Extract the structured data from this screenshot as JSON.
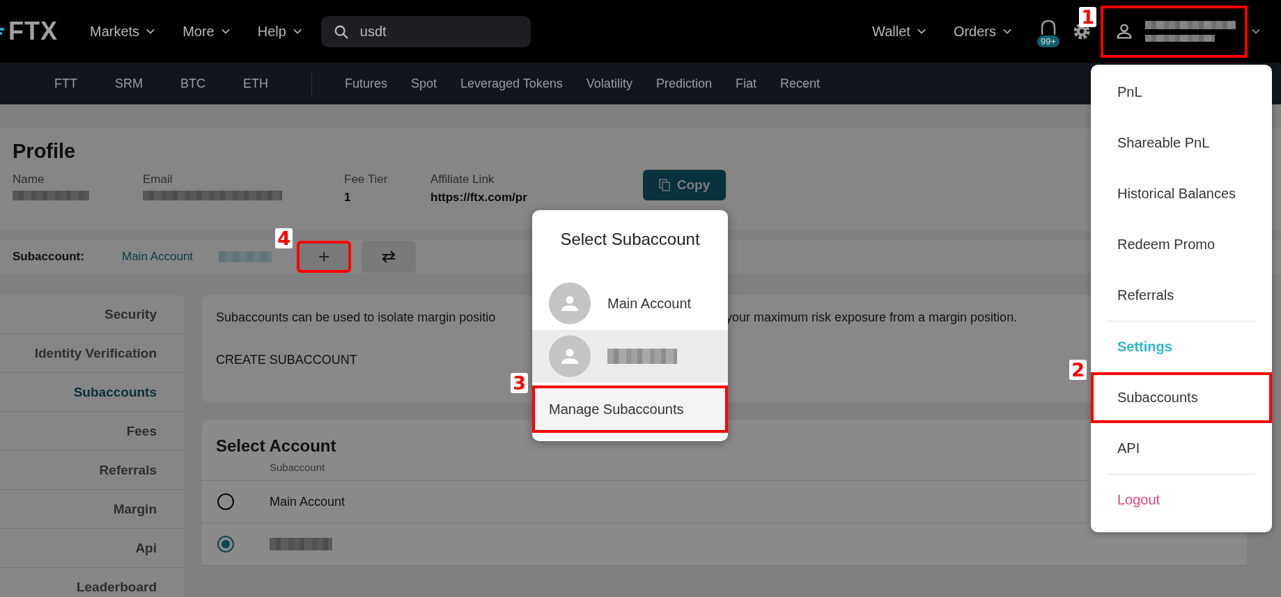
{
  "top_nav": {
    "logo": "FTX",
    "menus": [
      {
        "label": "Markets"
      },
      {
        "label": "More"
      },
      {
        "label": "Help"
      }
    ],
    "search": {
      "value": "usdt"
    },
    "right_menus": [
      {
        "label": "Wallet"
      },
      {
        "label": "Orders"
      }
    ],
    "notifications": {
      "badge": "99+"
    },
    "account_button": {
      "redacted": true,
      "highlighted": true,
      "callout": "1"
    }
  },
  "sub_nav": {
    "coins": [
      "FTT",
      "SRM",
      "BTC",
      "ETH"
    ],
    "categories": [
      "Futures",
      "Spot",
      "Leveraged Tokens",
      "Volatility",
      "Prediction",
      "Fiat",
      "Recent"
    ]
  },
  "profile": {
    "title": "Profile",
    "fields": [
      {
        "label": "Name",
        "redacted": true
      },
      {
        "label": "Email",
        "redacted": true
      },
      {
        "label": "Fee Tier",
        "value": "1"
      },
      {
        "label": "Affiliate Link",
        "value": "https://ftx.com/pr"
      }
    ],
    "copy_button": "Copy"
  },
  "subaccount_bar": {
    "label": "Subaccount:",
    "accounts": [
      {
        "name": "Main Account"
      },
      {
        "redacted": true
      }
    ],
    "add_button": {
      "label": "+",
      "highlighted": true,
      "callout": "4"
    }
  },
  "sidebar": {
    "items": [
      {
        "label": "Security",
        "selected": false
      },
      {
        "label": "Identity Verification",
        "selected": false
      },
      {
        "label": "Subaccounts",
        "selected": true
      },
      {
        "label": "Fees",
        "selected": false
      },
      {
        "label": "Referrals",
        "selected": false
      },
      {
        "label": "Margin",
        "selected": false
      },
      {
        "label": "Api",
        "selected": false
      },
      {
        "label": "Leaderboard",
        "selected": false
      }
    ]
  },
  "info_card": {
    "text_before": "Subaccounts can be used to isolate margin positio",
    "text_after": "your maximum risk exposure from a margin position.",
    "action": "CREATE SUBACCOUNT"
  },
  "select_account": {
    "title": "Select Account",
    "column": "Subaccount",
    "rows": [
      {
        "name": "Main Account",
        "selected": false
      },
      {
        "redacted": true,
        "selected": true
      }
    ]
  },
  "modal": {
    "title": "Select Subaccount",
    "accounts": [
      {
        "name": "Main Account",
        "selected": false
      },
      {
        "redacted": true,
        "selected": true
      }
    ],
    "manage": {
      "label": "Manage Subaccounts",
      "highlighted": true,
      "callout": "3"
    }
  },
  "account_menu": {
    "items": [
      {
        "kind": "item",
        "label": "PnL"
      },
      {
        "kind": "item",
        "label": "Shareable PnL"
      },
      {
        "kind": "item",
        "label": "Historical Balances"
      },
      {
        "kind": "item",
        "label": "Redeem Promo"
      },
      {
        "kind": "item",
        "label": "Referrals"
      },
      {
        "kind": "divider"
      },
      {
        "kind": "heading",
        "label": "Settings"
      },
      {
        "kind": "item",
        "label": "Subaccounts",
        "highlighted": true,
        "callout": "2"
      },
      {
        "kind": "item",
        "label": "API"
      },
      {
        "kind": "divider"
      },
      {
        "kind": "danger",
        "label": "Logout"
      }
    ]
  }
}
